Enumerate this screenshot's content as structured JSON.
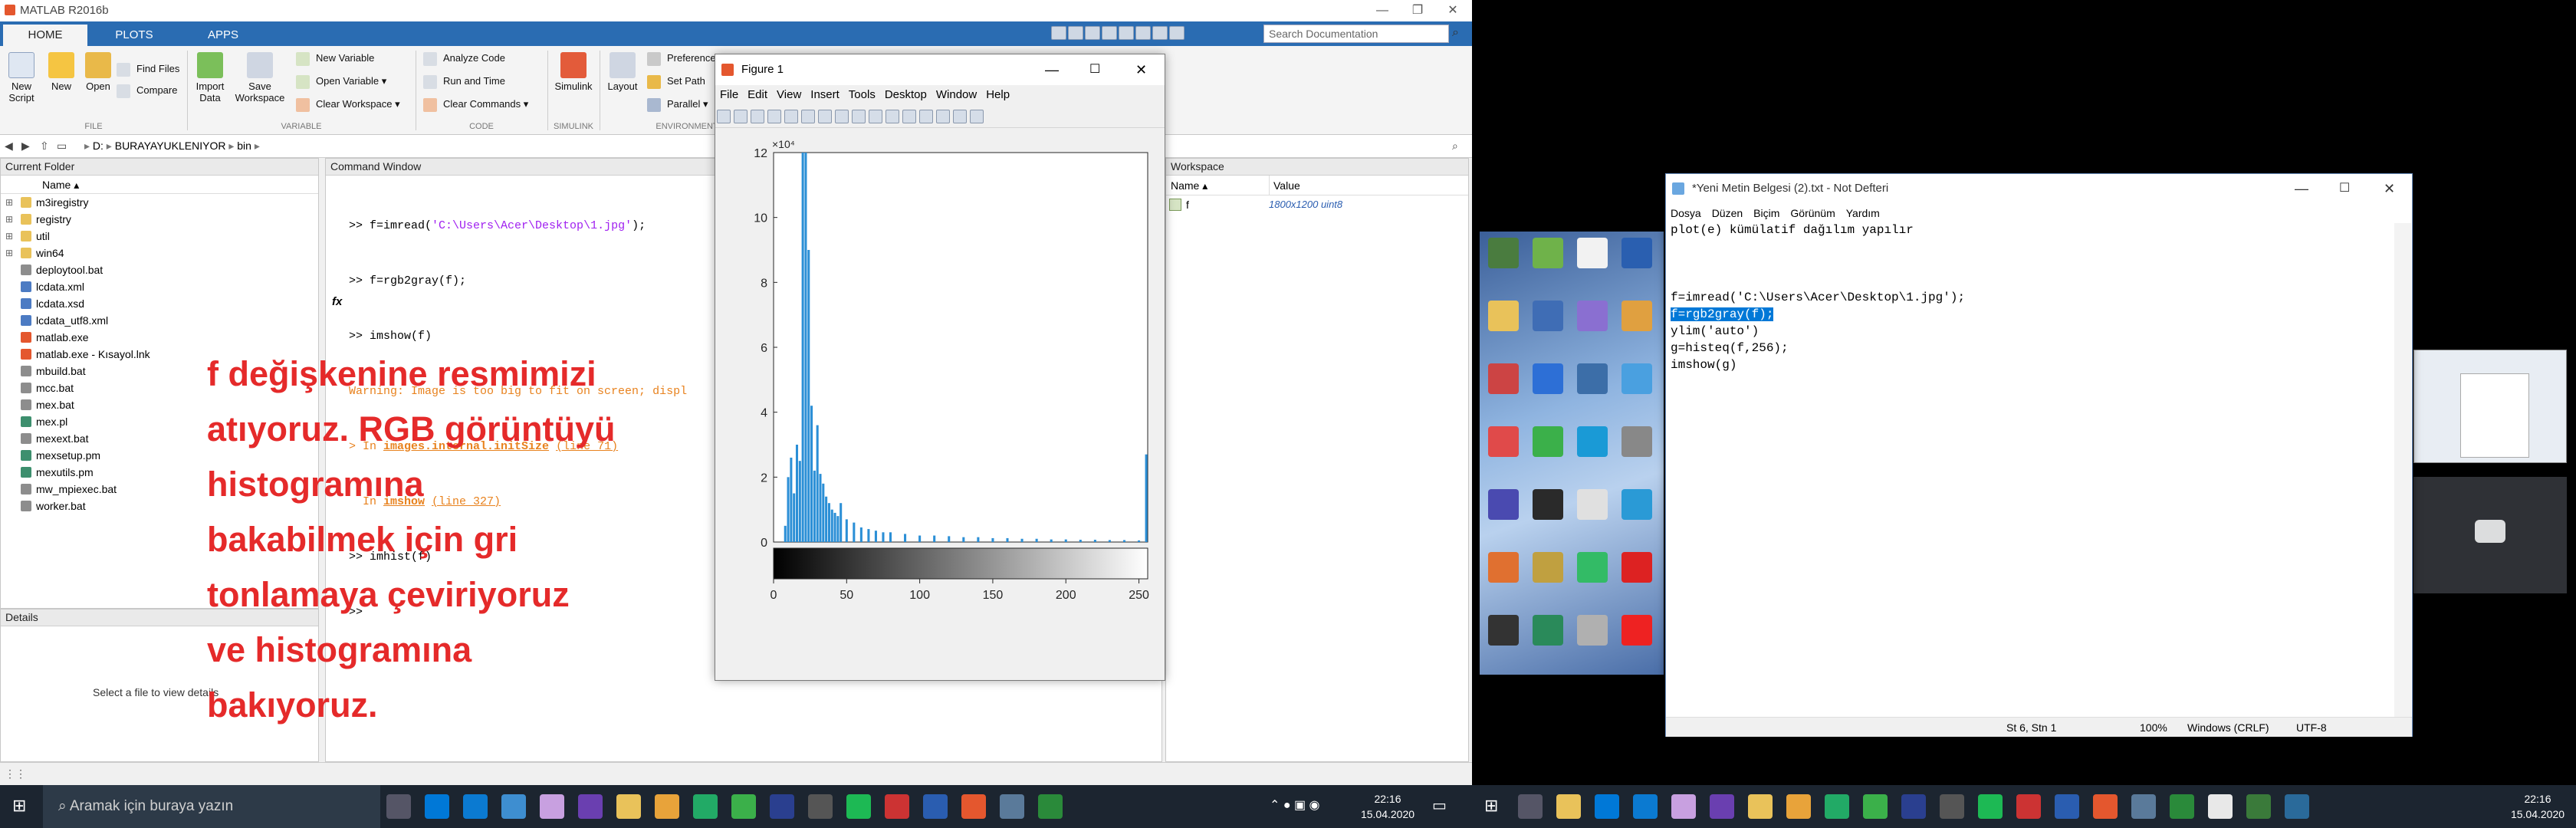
{
  "matlab": {
    "title": "MATLAB R2016b",
    "tabs": [
      "HOME",
      "PLOTS",
      "APPS"
    ],
    "search_placeholder": "Search Documentation",
    "ribbon": {
      "new_script": "New Script",
      "new": "New",
      "open": "Open",
      "find_files": "Find Files",
      "compare": "Compare",
      "import_data": "Import Data",
      "save_workspace": "Save Workspace",
      "new_variable": "New Variable",
      "open_variable": "Open Variable",
      "clear_workspace": "Clear Workspace",
      "analyze_code": "Analyze Code",
      "run_and_time": "Run and Time",
      "clear_commands": "Clear Commands",
      "simulink": "Simulink",
      "layout": "Layout",
      "preferences": "Preferences",
      "set_path": "Set Path",
      "parallel": "Parallel",
      "sections": [
        "FILE",
        "VARIABLE",
        "CODE",
        "SIMULINK",
        "ENVIRONMENT"
      ]
    },
    "address": [
      "D:",
      "BURAYAYUKLENIYOR",
      "bin"
    ],
    "current_folder": {
      "title": "Current Folder",
      "column": "Name",
      "items": [
        "m3iregistry",
        "registry",
        "util",
        "win64",
        "deploytool.bat",
        "lcdata.xml",
        "lcdata.xsd",
        "lcdata_utf8.xml",
        "matlab.exe",
        "matlab.exe - Kısayol.lnk",
        "mbuild.bat",
        "mcc.bat",
        "mex.bat",
        "mex.pl",
        "mexext.bat",
        "mexsetup.pm",
        "mexutils.pm",
        "mw_mpiexec.bat",
        "worker.bat"
      ]
    },
    "details": {
      "title": "Details",
      "empty_text": "Select a file to view details"
    },
    "command_window": {
      "title": "Command Window",
      "lines": [
        {
          "prompt": ">> ",
          "code": "f=imread(",
          "str": "'C:\\Users\\Acer\\Desktop\\1.jpg'",
          "end": ");"
        },
        {
          "prompt": ">> ",
          "code": "f=rgb2gray(f);"
        },
        {
          "prompt": ">> ",
          "code": "imshow(f)"
        }
      ],
      "warning": "Warning: Image is too big to fit on screen; displ",
      "trace1_pre": "> In ",
      "trace1_fn": "images.internal.initSize",
      "trace1_line": "(line 71)",
      "trace2_pre": "  In ",
      "trace2_fn": "imshow",
      "trace2_line": "(line 327)",
      "last": ">> imhist(f)",
      "prompt": ">>",
      "fx": "fx"
    },
    "workspace": {
      "title": "Workspace",
      "col_name": "Name",
      "col_value": "Value",
      "rows": [
        {
          "name": "f",
          "value": "1800x1200 uint8"
        }
      ]
    },
    "overlay_text": [
      "f değişkenine resmimizi",
      "atıyoruz. RGB görüntüyü",
      "histogramına",
      "bakabilmek için gri",
      "tonlamaya çeviriyoruz",
      "ve histogramına",
      "bakıyoruz."
    ]
  },
  "figure": {
    "title": "Figure 1",
    "menu": [
      "File",
      "Edit",
      "View",
      "Insert",
      "Tools",
      "Desktop",
      "Window",
      "Help"
    ]
  },
  "chart_data": {
    "type": "bar",
    "title": "",
    "xlabel": "",
    "ylabel": "",
    "y_exponent": "×10⁴",
    "xlim": [
      0,
      256
    ],
    "ylim": [
      0,
      12
    ],
    "x_ticks": [
      0,
      50,
      100,
      150,
      200,
      250
    ],
    "y_ticks": [
      0,
      2,
      4,
      6,
      8,
      10,
      12
    ],
    "bar_color": "#2b8fd6",
    "x": [
      8,
      10,
      12,
      14,
      16,
      18,
      20,
      22,
      24,
      26,
      28,
      30,
      32,
      34,
      36,
      38,
      40,
      42,
      44,
      46,
      50,
      55,
      60,
      65,
      70,
      75,
      80,
      90,
      100,
      110,
      120,
      130,
      140,
      150,
      160,
      170,
      180,
      190,
      200,
      210,
      220,
      230,
      240,
      250,
      255
    ],
    "values": [
      0.5,
      2.0,
      2.6,
      1.5,
      3.0,
      2.5,
      12.5,
      12.5,
      9.0,
      4.2,
      2.2,
      3.6,
      2.1,
      1.8,
      1.4,
      1.2,
      1.0,
      0.9,
      0.8,
      1.2,
      0.7,
      0.6,
      0.45,
      0.4,
      0.35,
      0.3,
      0.3,
      0.25,
      0.2,
      0.2,
      0.18,
      0.15,
      0.15,
      0.12,
      0.12,
      0.1,
      0.1,
      0.08,
      0.08,
      0.07,
      0.07,
      0.06,
      0.06,
      0.05,
      2.7
    ]
  },
  "notepad": {
    "title": "*Yeni Metin Belgesi (2).txt - Not Defteri",
    "menu": [
      "Dosya",
      "Düzen",
      "Biçim",
      "Görünüm",
      "Yardım"
    ],
    "lines": [
      "plot(e) kümülatif dağılım yapılır",
      "",
      "",
      "",
      "f=imread('C:\\Users\\Acer\\Desktop\\1.jpg');",
      "f=rgb2gray(f);",
      "ylim('auto')",
      "g=histeq(f,256);",
      "imshow(g)"
    ],
    "selected_line": 5,
    "status": {
      "position": "St 6, Stn 1",
      "zoom": "100%",
      "eol": "Windows (CRLF)",
      "encoding": "UTF-8"
    }
  },
  "taskbar": {
    "search": "Aramak için buraya yazın",
    "left_clock": {
      "time": "22:16",
      "date": "15.04.2020"
    },
    "right_clock": {
      "time": "22:16",
      "date": "15.04.2020"
    }
  }
}
